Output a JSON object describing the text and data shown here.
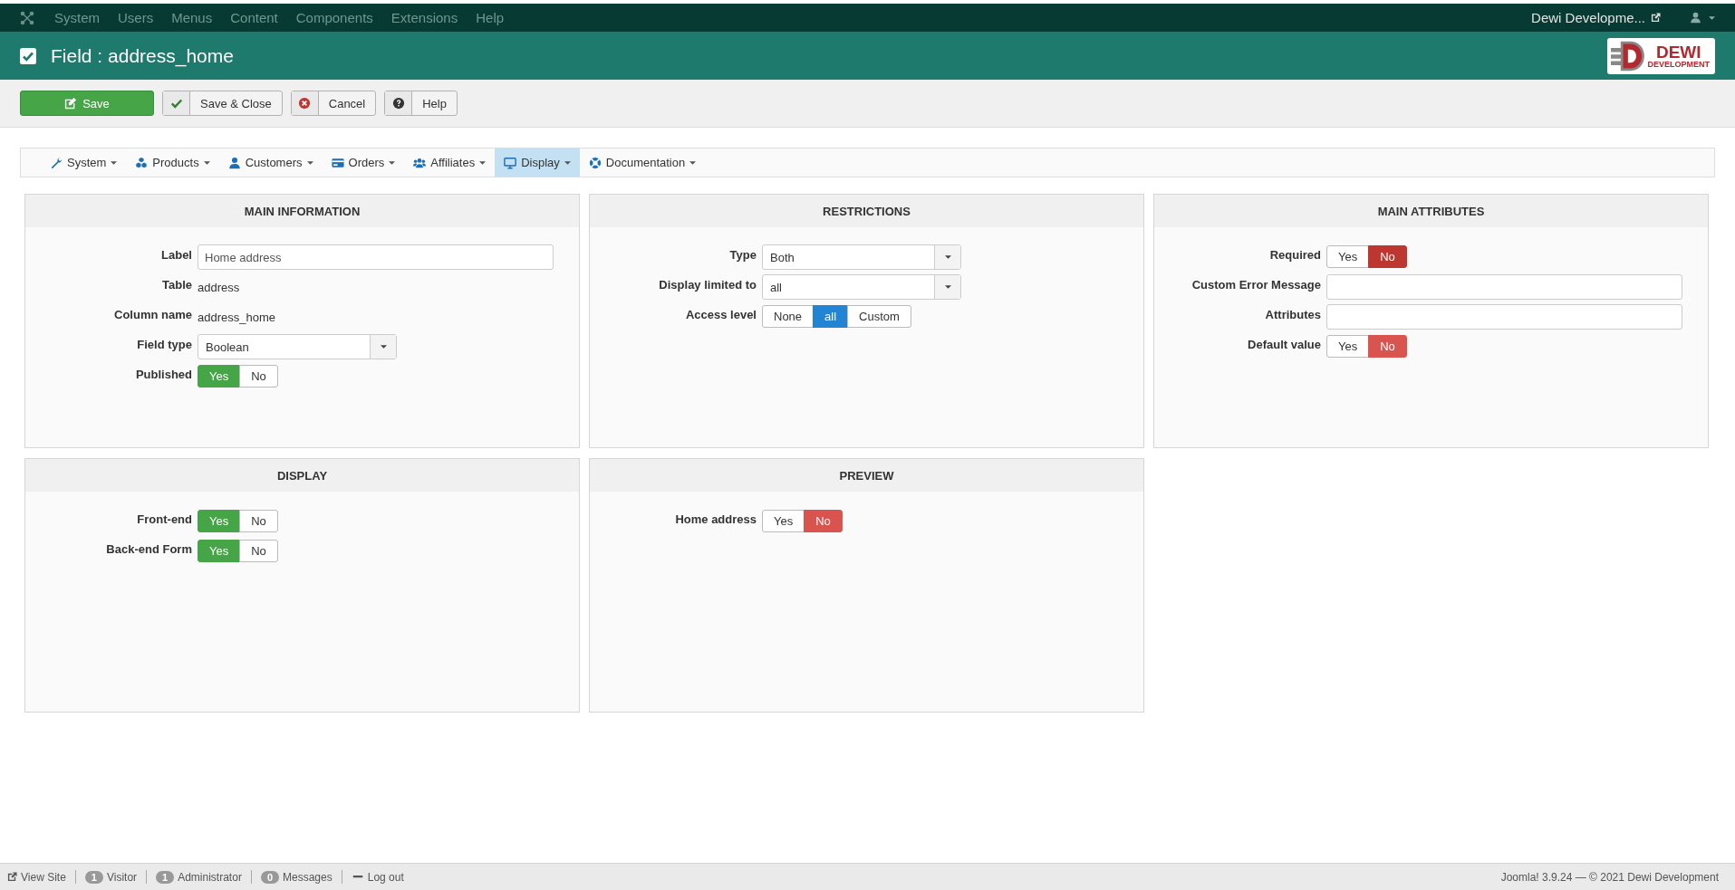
{
  "topbar": {
    "menu": [
      "System",
      "Users",
      "Menus",
      "Content",
      "Components",
      "Extensions",
      "Help"
    ],
    "site_link": "Dewi Developme..."
  },
  "header": {
    "title": "Field : address_home",
    "logo": {
      "name": "DEWI",
      "tagline": "DEVELOPMENT"
    }
  },
  "toolbar": [
    {
      "kind": "save",
      "label": "Save"
    },
    {
      "kind": "save-close",
      "label": "Save & Close"
    },
    {
      "kind": "cancel",
      "label": "Cancel"
    },
    {
      "kind": "help",
      "label": "Help"
    }
  ],
  "menubar": [
    {
      "kind": "wrench",
      "label": "System",
      "selected": false
    },
    {
      "kind": "cubes",
      "label": "Products",
      "selected": false
    },
    {
      "kind": "user",
      "label": "Customers",
      "selected": false
    },
    {
      "kind": "card",
      "label": "Orders",
      "selected": false
    },
    {
      "kind": "users",
      "label": "Affiliates",
      "selected": false
    },
    {
      "kind": "monitor",
      "label": "Display",
      "selected": true
    },
    {
      "kind": "lifering",
      "label": "Documentation",
      "selected": false
    }
  ],
  "panels": [
    {
      "title": "MAIN INFORMATION",
      "fields": [
        {
          "kind": "text",
          "label": "Label",
          "value": "Home address"
        },
        {
          "kind": "static",
          "label": "Table",
          "value": "address"
        },
        {
          "kind": "static",
          "label": "Column name",
          "value": "address_home"
        },
        {
          "kind": "select",
          "label": "Field type",
          "value": "Boolean"
        },
        {
          "kind": "toggle",
          "label": "Published",
          "options": [
            {
              "label": "Yes",
              "selected": true,
              "color": "#46a546"
            },
            {
              "label": "No",
              "selected": false
            }
          ]
        }
      ]
    },
    {
      "title": "RESTRICTIONS",
      "fields": [
        {
          "kind": "select",
          "label": "Type",
          "value": "Both"
        },
        {
          "kind": "select",
          "label": "Display limited to",
          "value": "all"
        },
        {
          "kind": "toggle",
          "label": "Access level",
          "options": [
            {
              "label": "None",
              "selected": false
            },
            {
              "label": "all",
              "selected": true,
              "color": "#2384d3"
            },
            {
              "label": "Custom",
              "selected": false
            }
          ]
        }
      ]
    },
    {
      "title": "MAIN ATTRIBUTES",
      "fields": [
        {
          "kind": "toggle",
          "label": "Required",
          "options": [
            {
              "label": "Yes",
              "selected": false
            },
            {
              "label": "No",
              "selected": true,
              "color": "#bd362f"
            }
          ]
        },
        {
          "kind": "text",
          "label": "Custom Error Message"
        },
        {
          "kind": "text",
          "label": "Attributes"
        },
        {
          "kind": "toggle",
          "label": "Default value",
          "options": [
            {
              "label": "Yes",
              "selected": false
            },
            {
              "label": "No",
              "selected": true,
              "color": "#d9534f"
            }
          ]
        }
      ]
    },
    {
      "title": "DISPLAY",
      "fields": [
        {
          "kind": "toggle",
          "label": "Front-end",
          "options": [
            {
              "label": "Yes",
              "selected": true,
              "color": "#46a546"
            },
            {
              "label": "No",
              "selected": false
            }
          ]
        },
        {
          "kind": "toggle",
          "label": "Back-end Form",
          "options": [
            {
              "label": "Yes",
              "selected": true,
              "color": "#46a546"
            },
            {
              "label": "No",
              "selected": false
            }
          ]
        }
      ]
    },
    {
      "title": "PREVIEW",
      "fields": [
        {
          "kind": "toggle",
          "label": "Home address",
          "options": [
            {
              "label": "Yes",
              "selected": false
            },
            {
              "label": "No",
              "selected": true,
              "color": "#d9534f"
            }
          ]
        }
      ]
    }
  ],
  "status_bar": {
    "items": [
      {
        "kind": "view-site",
        "label": "View Site"
      },
      {
        "kind": "count",
        "count": "1",
        "label": "Visitor"
      },
      {
        "kind": "count",
        "count": "1",
        "label": "Administrator"
      },
      {
        "kind": "count",
        "count": "0",
        "label": "Messages"
      },
      {
        "kind": "logout",
        "label": "Log out"
      }
    ],
    "right": "Joomla! 3.9.24 — © 2021 Dewi Development"
  }
}
